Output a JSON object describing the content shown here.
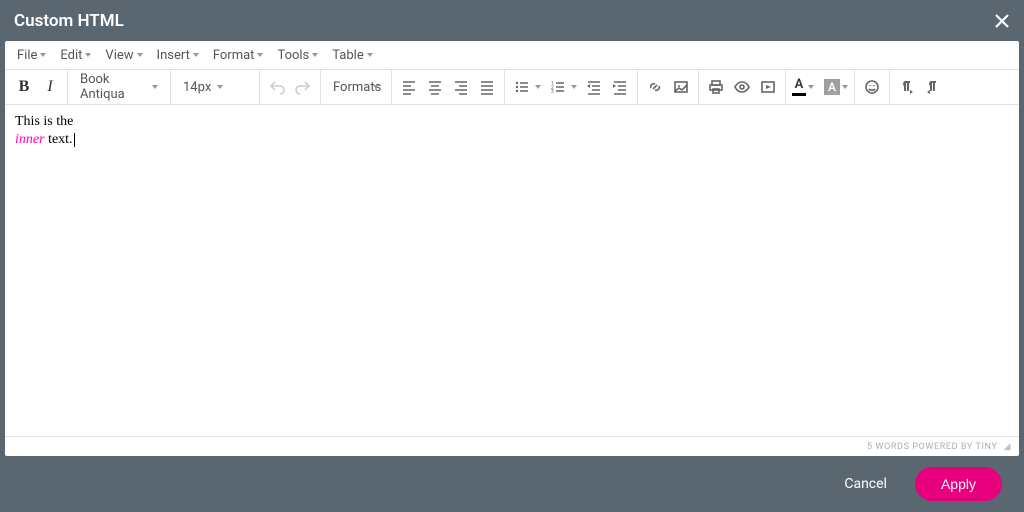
{
  "modal": {
    "title": "Custom HTML"
  },
  "menubar": {
    "file": "File",
    "edit": "Edit",
    "view": "View",
    "insert": "Insert",
    "format": "Format",
    "tools": "Tools",
    "table": "Table"
  },
  "toolbar": {
    "font_family": "Book Antiqua",
    "font_size": "14px",
    "formats_label": "Formats"
  },
  "content": {
    "line1": "This is the",
    "line2_word": "inner",
    "line2_rest": " text."
  },
  "status": {
    "text": "5 WORDS POWERED BY TINY"
  },
  "footer": {
    "cancel": "Cancel",
    "apply": "Apply"
  },
  "colors": {
    "accent": "#e6007e"
  }
}
